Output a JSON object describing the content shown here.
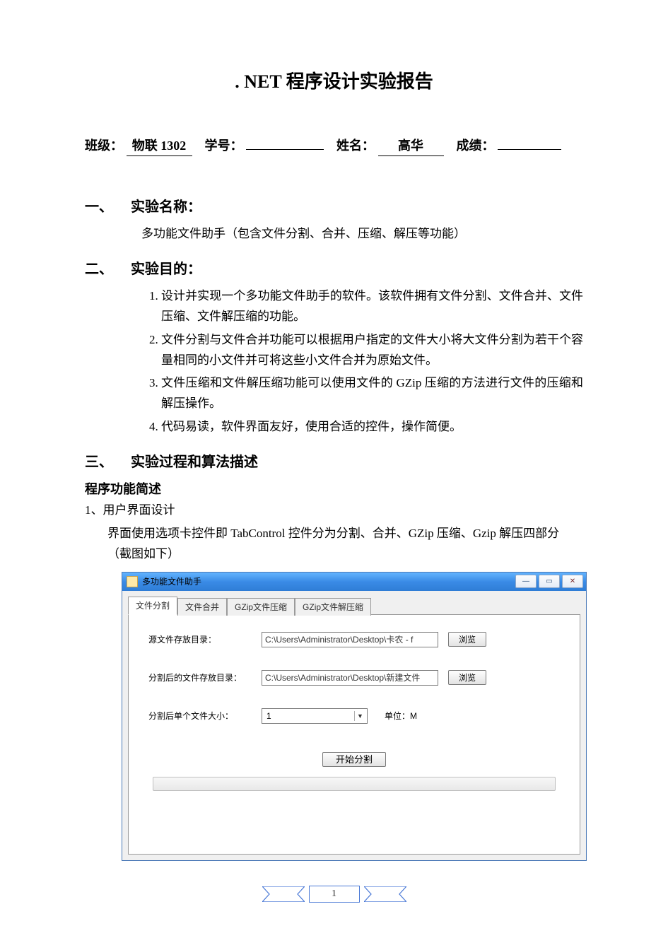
{
  "doc": {
    "title": ". NET 程序设计实验报告",
    "info": {
      "class_label": "班级：",
      "class_value": "物联 1302",
      "id_label": "学号：",
      "name_label": "姓名：",
      "name_value": "高华",
      "score_label": "成绩："
    },
    "section1": {
      "num": "一、",
      "heading": "实验名称：",
      "body": "多功能文件助手（包含文件分割、合并、压缩、解压等功能）"
    },
    "section2": {
      "num": "二、",
      "heading": "实验目的：",
      "items": [
        "设计并实现一个多功能文件助手的软件。该软件拥有文件分割、文件合并、文件压缩、文件解压缩的功能。",
        "文件分割与文件合并功能可以根据用户指定的文件大小将大文件分割为若干个容量相同的小文件并可将这些小文件合并为原始文件。",
        "文件压缩和文件解压缩功能可以使用文件的 GZip 压缩的方法进行文件的压缩和解压操作。",
        "代码易读，软件界面友好，使用合适的控件，操作简便。"
      ]
    },
    "section3": {
      "num": "三、",
      "heading": "实验过程和算法描述"
    },
    "sub_heading": "程序功能简述",
    "sub_item_num": "1、",
    "sub_item_title": "用户界面设计",
    "sub_item_body": "界面使用选项卡控件即 TabControl 控件分为分割、合并、GZip 压缩、Gzip 解压四部分（截图如下）"
  },
  "app": {
    "window_title": "多功能文件助手",
    "tabs": [
      "文件分割",
      "文件合并",
      "GZip文件压缩",
      "GZip文件解压缩"
    ],
    "labels": {
      "src_dir": "源文件存放目录：",
      "out_dir": "分割后的文件存放目录：",
      "size": "分割后单个文件大小：",
      "unit": "单位：M"
    },
    "values": {
      "src_dir": "C:\\Users\\Administrator\\Desktop\\卡农 - f",
      "out_dir": "C:\\Users\\Administrator\\Desktop\\新建文件",
      "size": "1"
    },
    "buttons": {
      "browse": "浏览",
      "start": "开始分割"
    },
    "win_controls": {
      "minimize": "—",
      "maximize": "▭",
      "close": "✕"
    }
  },
  "footer": {
    "page_number": "1"
  }
}
